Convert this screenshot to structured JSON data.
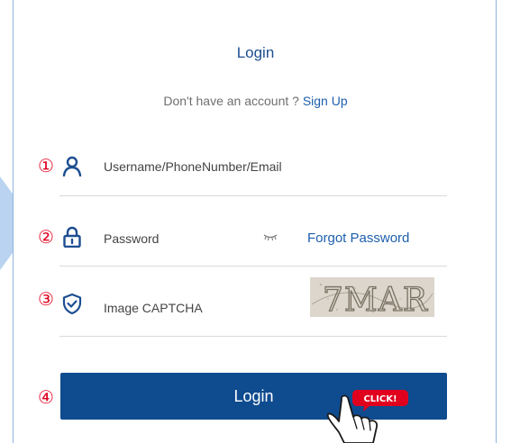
{
  "form": {
    "title": "Login",
    "signup_prompt": "Don't have an account ?",
    "signup_link": "Sign Up",
    "steps": [
      "①",
      "②",
      "③",
      "④"
    ],
    "username": {
      "placeholder": "Username/PhoneNumber/Email",
      "icon": "user-icon"
    },
    "password": {
      "placeholder": "Password",
      "icon": "lock-icon",
      "toggle_icon": "eye-closed-icon",
      "forgot_link": "Forgot Password"
    },
    "captcha": {
      "placeholder": "Image CAPTCHA",
      "icon": "shield-check-icon",
      "image_text": "7MAR"
    },
    "login_button": "Login",
    "click_badge": "CLICK!"
  },
  "colors": {
    "accent": "#1d4e91",
    "link": "#1d5fae",
    "button": "#0e4b8f",
    "step_number": "#e0001e",
    "badge": "#e0001e"
  }
}
